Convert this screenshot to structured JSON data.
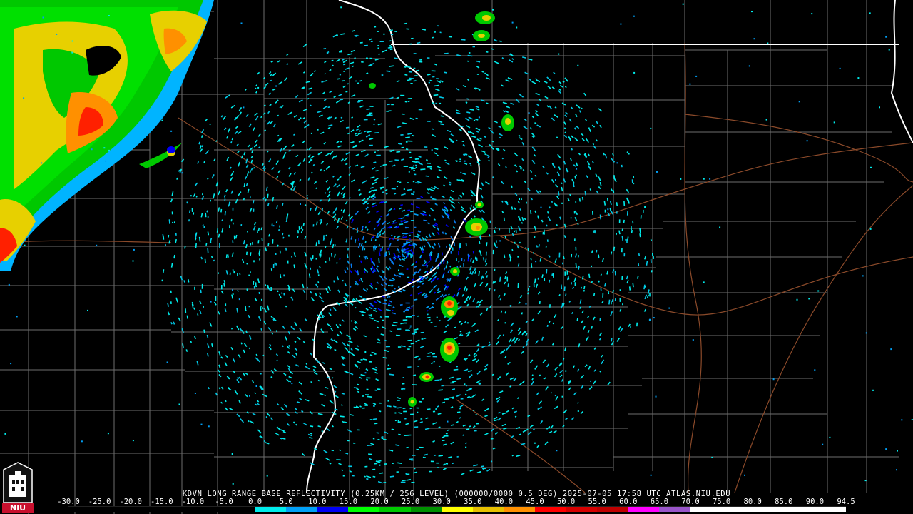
{
  "map": {
    "station": "KDVN",
    "product": "LONG RANGE BASE REFLECTIVITY",
    "caption": "KDVN LONG RANGE BASE REFLECTIVITY (0.25KM / 256 LEVEL) (000000/0000 0.5 DEG) 2025-07-05 17:58 UTC  ATLAS.NIU.EDU",
    "background_color": "#000000",
    "county_line_color": "#7a7a7a",
    "state_line_color": "#ffffff",
    "road_color": "#8b4a2a"
  },
  "legend": {
    "units_labels": [
      "-30.0",
      "-25.0",
      "-20.0",
      "-15.0",
      "-10.0",
      "-5.0",
      "0.0",
      "5.0",
      "10.0",
      "15.0",
      "20.0",
      "25.0",
      "30.0",
      "35.0",
      "40.0",
      "45.0",
      "50.0",
      "55.0",
      "60.0",
      "65.0",
      "70.0",
      "75.0",
      "80.0",
      "85.0",
      "90.0",
      "94.5"
    ],
    "colors": [
      "#000000",
      "#000000",
      "#000000",
      "#000000",
      "#000000",
      "#000000",
      "#00ecec",
      "#01a0f6",
      "#0000f6",
      "#00ff00",
      "#00c800",
      "#009000",
      "#ffff00",
      "#e7c000",
      "#ff9000",
      "#ff0000",
      "#d60000",
      "#c00000",
      "#ff00ff",
      "#9955c9",
      "#ffffff",
      "#ffffff",
      "#ffffff",
      "#ffffff",
      "#ffffff"
    ]
  },
  "logo": {
    "text": "NIU",
    "color": "#c8102e"
  }
}
